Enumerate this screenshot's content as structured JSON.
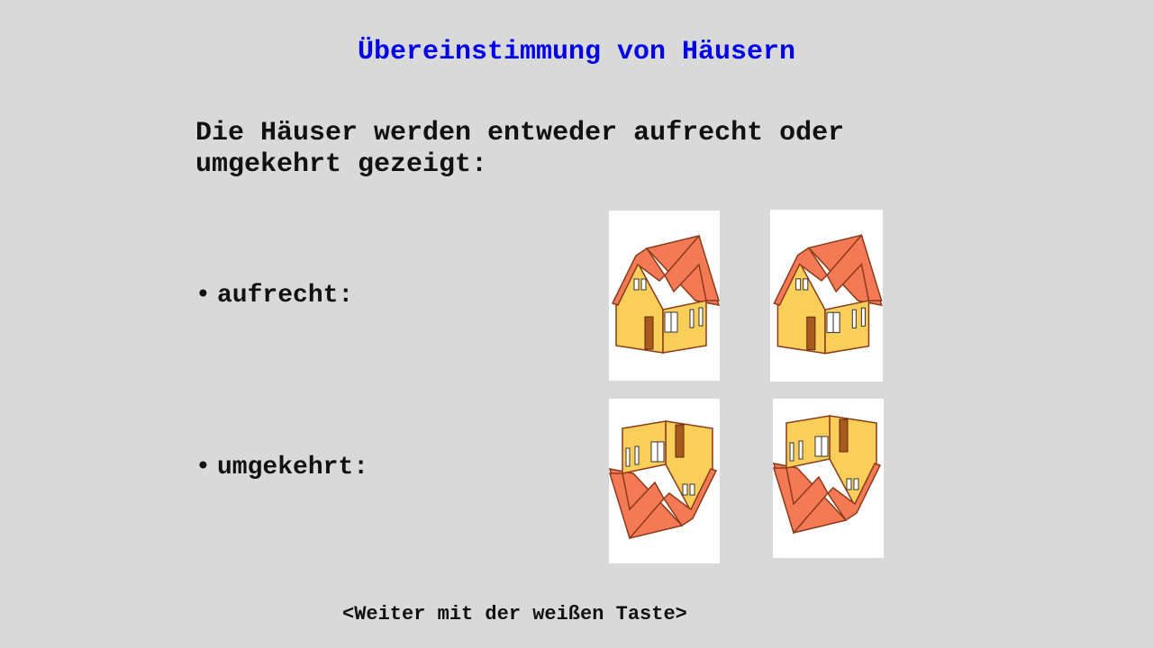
{
  "screen": {
    "title": "Übereinstimmung von Häusern",
    "intro": "Die Häuser werden entweder aufrecht oder umgekehrt gezeigt:",
    "rows": [
      {
        "bullet": "•",
        "label": "aufrecht:"
      },
      {
        "bullet": "•",
        "label": "umgekehrt:"
      }
    ],
    "footer": "<Weiter mit der weißen Taste>"
  },
  "colors": {
    "background": "#d9d9d9",
    "title": "#0000ee",
    "text": "#111111",
    "card": "#ffffff",
    "roof": "#f47a55",
    "wall": "#f9cf5a",
    "outline": "#8a3b1a"
  },
  "cards": [
    {
      "icon": "house-upright-icon",
      "orientation": "upright"
    },
    {
      "icon": "house-upright-icon",
      "orientation": "upright"
    },
    {
      "icon": "house-inverted-icon",
      "orientation": "inverted"
    },
    {
      "icon": "house-inverted-icon",
      "orientation": "inverted"
    }
  ]
}
